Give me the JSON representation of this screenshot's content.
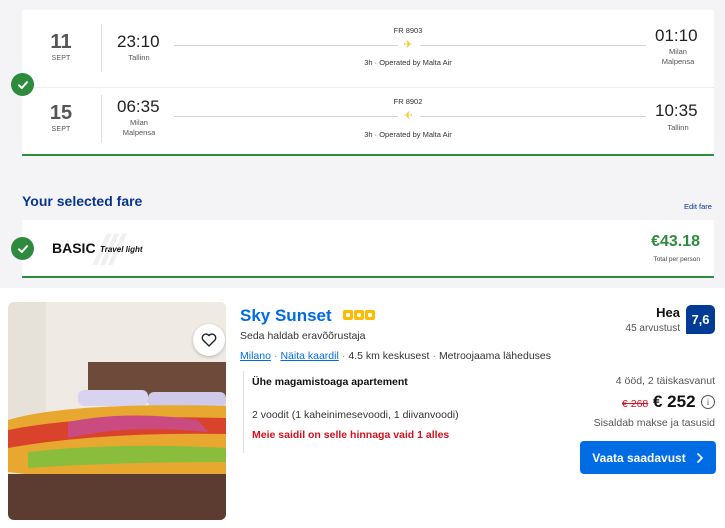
{
  "flights": {
    "outbound": {
      "day": "11",
      "month": "SEPT",
      "dep_time": "23:10",
      "dep_city": "Tallinn",
      "flight_no": "FR 8903",
      "duration_operator": "3h · Operated by Malta Air",
      "arr_time": "01:10",
      "arr_city_line1": "Milan",
      "arr_city_line2": "Malpensa"
    },
    "inbound": {
      "day": "15",
      "month": "SEPT",
      "dep_time": "06:35",
      "dep_city_line1": "Milan",
      "dep_city_line2": "Malpensa",
      "flight_no": "FR 8902",
      "duration_operator": "3h · Operated by Malta Air",
      "arr_time": "10:35",
      "arr_city": "Tallinn"
    }
  },
  "fare": {
    "section_title": "Your selected fare",
    "edit_link": "Edit fare",
    "name": "BASIC",
    "subtitle": "Travel light",
    "price": "€43.18",
    "per_person": "Total per person"
  },
  "hotel": {
    "name": "Sky Sunset",
    "stars": 3,
    "operated_by": "Seda haldab eravõõrustaja",
    "city_link": "Milano",
    "map_link": "Näita kaardil",
    "distance": "4.5 km keskusest",
    "metro": "Metroojaama läheduses",
    "room_type": "Ühe magamistoaga apartement",
    "beds": "2 voodit (1 kaheinimesevoodi, 1 diivanvoodi)",
    "scarcity": "Meie saidil on selle hinnaga vaid 1 alles",
    "rating_word": "Hea",
    "reviews": "45 arvustust",
    "score": "7,6",
    "stay": "4 ööd, 2 täiskasvanut",
    "old_price": "€ 268",
    "new_price": "€ 252",
    "taxes": "Sisaldab makse ja tasusid",
    "cta": "Vaata saadavust"
  },
  "colors": {
    "green": "#2e8b3e",
    "navy": "#073590",
    "blue": "#006ce4",
    "red": "#d4111e",
    "star": "#febb02"
  }
}
